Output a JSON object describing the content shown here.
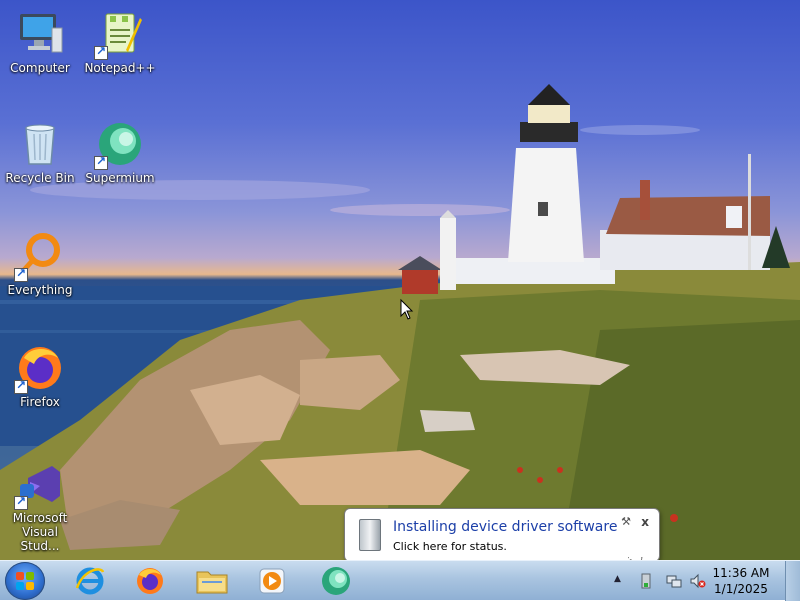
{
  "desktop_icons": [
    {
      "label": "Computer"
    },
    {
      "label": "Notepad++"
    },
    {
      "label": "Recycle Bin"
    },
    {
      "label": "Supermium"
    },
    {
      "label": "Everything"
    },
    {
      "label": "Firefox"
    },
    {
      "label": "Microsoft Visual Stud..."
    }
  ],
  "notification": {
    "title": "Installing device driver software",
    "subtitle": "Click here for status.",
    "close_glyph": "x",
    "options_glyph": "⚒"
  },
  "taskbar": {
    "pinned": [
      "start-orb",
      "internet-explorer",
      "firefox",
      "file-explorer",
      "media-player",
      "supermium"
    ]
  },
  "clock": {
    "time": "11:36 AM",
    "date": "1/1/2025"
  },
  "tray": {
    "show_hidden_glyph": "▲"
  },
  "colors": {
    "balloon_title": "#1c3fa8",
    "taskbar": "#a9c4e0"
  }
}
